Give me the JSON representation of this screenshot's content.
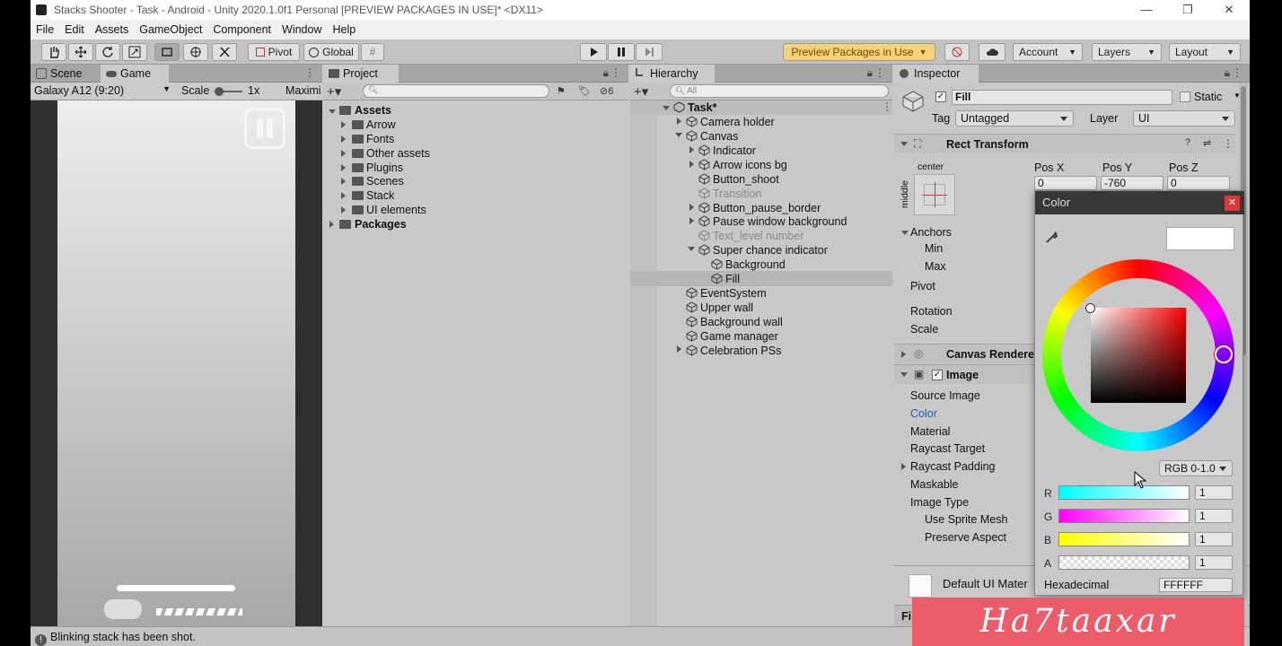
{
  "window": {
    "title": "Stacks Shooter - Task - Android - Unity 2020.1.0f1 Personal [PREVIEW PACKAGES IN USE]* <DX11>"
  },
  "menu": [
    "File",
    "Edit",
    "Assets",
    "GameObject",
    "Component",
    "Window",
    "Help"
  ],
  "toolbar": {
    "pivot": "Pivot",
    "global": "Global",
    "preview_packages": "Preview Packages in Use",
    "account": "Account",
    "layers": "Layers",
    "layout": "Layout"
  },
  "game": {
    "tab_scene": "Scene",
    "tab_game": "Game",
    "resolution": "Galaxy A12 (9:20)",
    "scale_label": "Scale",
    "scale_value": "1x",
    "maximize": "Maximi"
  },
  "project": {
    "tab": "Project",
    "hidden_count": "6",
    "root": "Assets",
    "folders": [
      "Arrow",
      "Fonts",
      "Other assets",
      "Plugins",
      "Scenes",
      "Stack",
      "UI elements"
    ],
    "packages": "Packages"
  },
  "hierarchy": {
    "tab": "Hierarchy",
    "search_placeholder": "All",
    "scene": "Task*",
    "items": [
      "Camera holder",
      "Canvas",
      "Indicator",
      "Arrow icons bg",
      "Button_shoot",
      "Transition",
      "Button_pause_border",
      "Pause window background",
      "Text_level number",
      "Super chance indicator",
      "Background",
      "Fill",
      "EventSystem",
      "Upper wall",
      "Background wall",
      "Game manager",
      "Celebration PSs"
    ]
  },
  "inspector": {
    "tab": "Inspector",
    "object_name": "Fill",
    "static_label": "Static",
    "tag_label": "Tag",
    "tag_value": "Untagged",
    "layer_label": "Layer",
    "layer_value": "UI",
    "rect_transform": "Rect Transform",
    "anchor_h": "center",
    "anchor_v": "middle",
    "pos_x_label": "Pos X",
    "pos_y_label": "Pos Y",
    "pos_z_label": "Pos Z",
    "pos_x": "0",
    "pos_y": "-760",
    "pos_z": "0",
    "anchors": "Anchors",
    "min": "Min",
    "max": "Max",
    "pivot": "Pivot",
    "rotation": "Rotation",
    "scale": "Scale",
    "canvas_renderer": "Canvas Renderer",
    "image": "Image",
    "source_image": "Source Image",
    "color": "Color",
    "material": "Material",
    "raycast_target": "Raycast Target",
    "raycast_padding": "Raycast Padding",
    "maskable": "Maskable",
    "image_type": "Image Type",
    "use_sprite_mesh": "Use Sprite Mesh",
    "preserve_aspect": "Preserve Aspect",
    "default_material": "Default UI Mater",
    "fill_partial": "Fil"
  },
  "color_picker": {
    "title": "Color",
    "mode": "RGB 0-1.0",
    "r_label": "R",
    "g_label": "G",
    "b_label": "B",
    "a_label": "A",
    "r": "1",
    "g": "1",
    "b": "1",
    "a": "1",
    "hex_label": "Hexadecimal",
    "hex": "FFFFFF"
  },
  "status": {
    "message": "Blinking stack has been shot."
  },
  "watermark": "Ha7taaxar",
  "colors": {
    "accent_selection": "#b6b6b6",
    "link_blue": "#1f5fbf",
    "close_red": "#d93838"
  }
}
